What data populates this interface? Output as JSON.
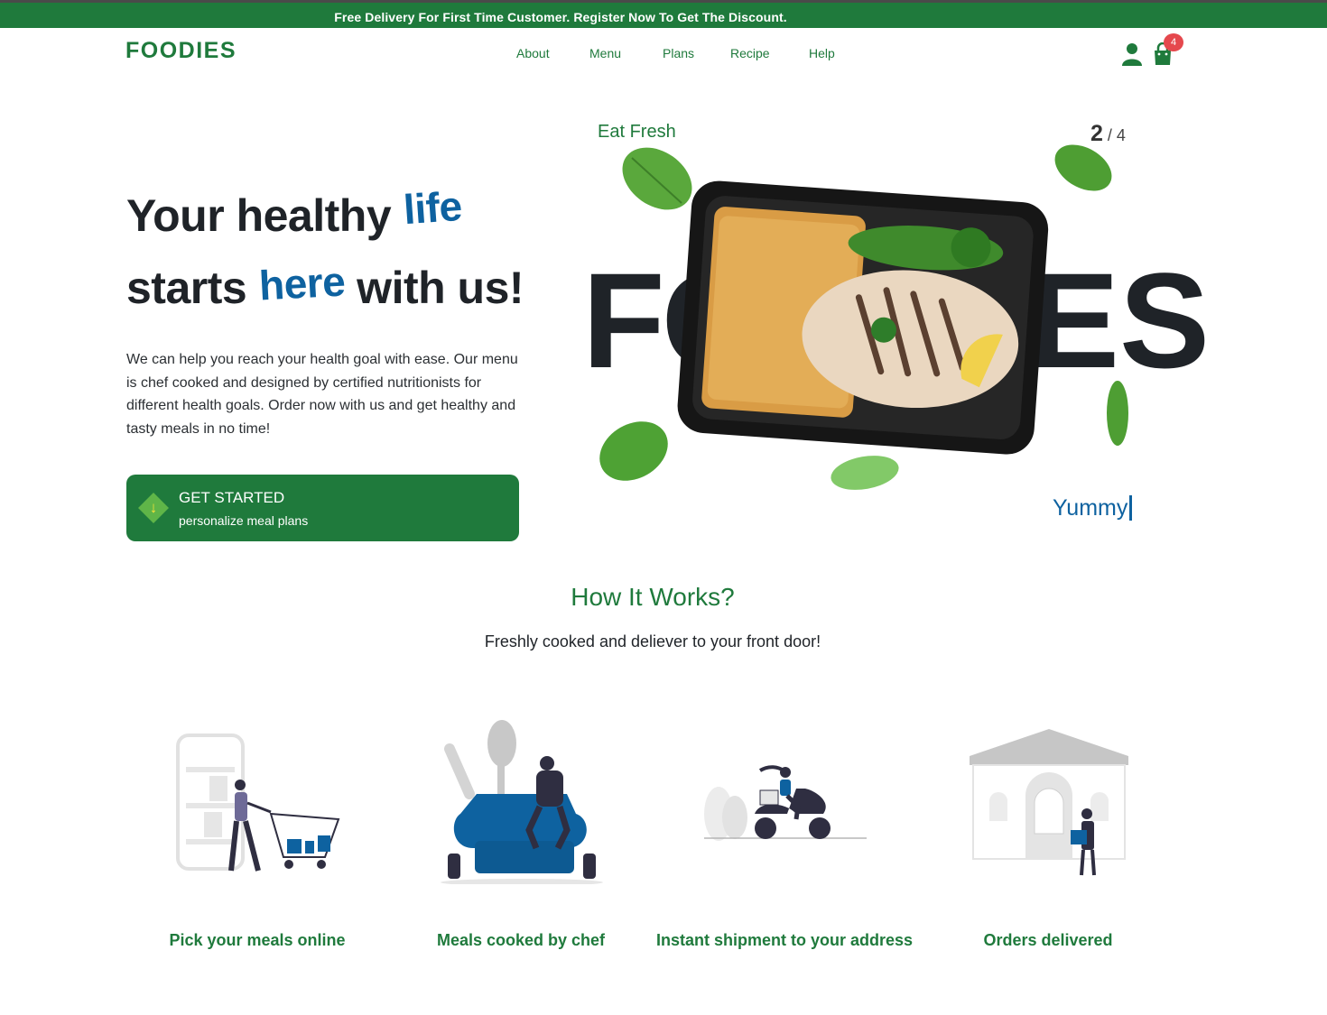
{
  "promo": {
    "text": "Free Delivery For First Time Customer. Register Now To Get The Discount."
  },
  "header": {
    "logo": "FOODIES",
    "nav": [
      "About",
      "Menu",
      "Plans",
      "Recipe",
      "Help"
    ],
    "cart_count": "4",
    "icons": {
      "account": "user-icon",
      "cart": "shopping-bag-icon"
    }
  },
  "hero": {
    "line1": "Your healthy",
    "accent1": "life",
    "line2_start": "starts",
    "accent2": "here",
    "line2_end": "with us!",
    "description": "We can help you reach your health goal with ease. Our menu is chef cooked and designed by certified nutritionists for different health goals. Order now with us and get healthy and tasty meals in no time!",
    "cta": {
      "title": "GET STARTED",
      "subtitle": "personalize meal plans"
    }
  },
  "slider": {
    "caption_top": "Eat Fresh",
    "current": "2",
    "separator": " / ",
    "total": "4",
    "caption_bottom": "Yummy",
    "brand_left": "FO",
    "brand_right": "ES"
  },
  "how_it_works": {
    "title": "How It Works?",
    "subtitle": "Freshly cooked and deliever to your front door!",
    "steps": [
      {
        "label": "Pick your meals online"
      },
      {
        "label": "Meals cooked by chef"
      },
      {
        "label": "Instant shipment to your address"
      },
      {
        "label": "Orders delivered"
      }
    ]
  },
  "colors": {
    "brand_green": "#1f7a3c",
    "accent_blue": "#0e62a0",
    "badge_red": "#e5484d"
  }
}
